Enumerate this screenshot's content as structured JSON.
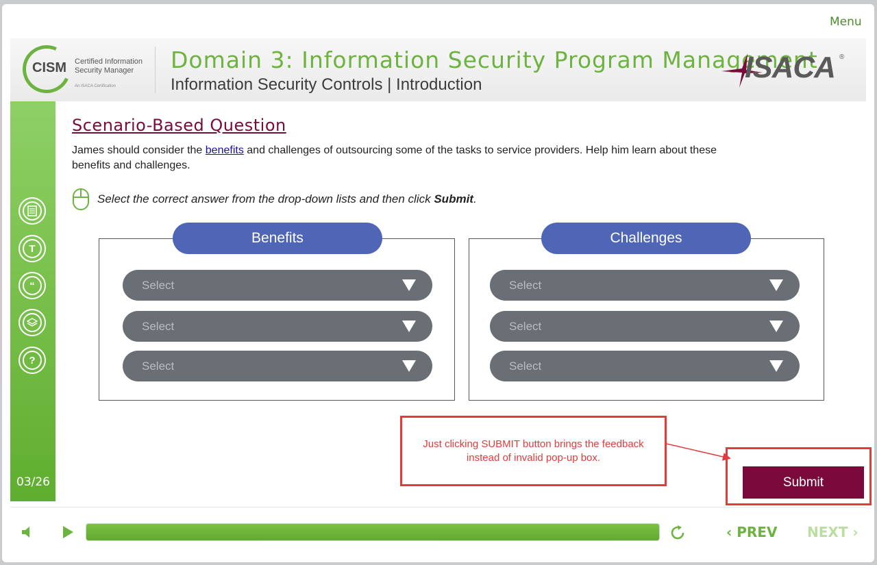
{
  "top": {
    "menu_label": "Menu"
  },
  "header": {
    "logo_abbr": "CISM",
    "logo_line1": "Certified Information",
    "logo_line2": "Security Manager",
    "logo_line3": "An ISACA Certification",
    "domain_title": "Domain 3: Information Security Program Management",
    "subtitle": "Information Security Controls | Introduction",
    "brand": "ISACA"
  },
  "sidebar": {
    "icons": [
      "glossary-icon",
      "transcript-icon",
      "quote-icon",
      "resources-icon",
      "help-icon"
    ],
    "page_indicator": "03/26"
  },
  "content": {
    "title": "Scenario-Based Question",
    "intro_before": "James should consider the ",
    "intro_link": "benefits",
    "intro_after": " and challenges of outsourcing some of the tasks to service providers. Help him learn about these benefits and challenges.",
    "instruction_text": "Select the correct answer from the drop-down lists and then click ",
    "instruction_bold": "Submit",
    "instruction_end": "."
  },
  "benefits": {
    "header": "Benefits",
    "selects": [
      "Select",
      "Select",
      "Select"
    ]
  },
  "challenges": {
    "header": "Challenges",
    "selects": [
      "Select",
      "Select",
      "Select"
    ]
  },
  "annotation": {
    "note": "Just clicking SUBMIT button brings the feedback instead of invalid pop-up box.",
    "color": "#e33b3b"
  },
  "actions": {
    "submit_label": "Submit"
  },
  "footer": {
    "prev_label": "PREV",
    "next_label": "NEXT",
    "progress_percent": 100
  },
  "colors": {
    "accent_green": "#6cb33f",
    "header_blue": "#4f65b6",
    "maroon": "#7b0a3c",
    "select_gray": "#6a6f75"
  }
}
